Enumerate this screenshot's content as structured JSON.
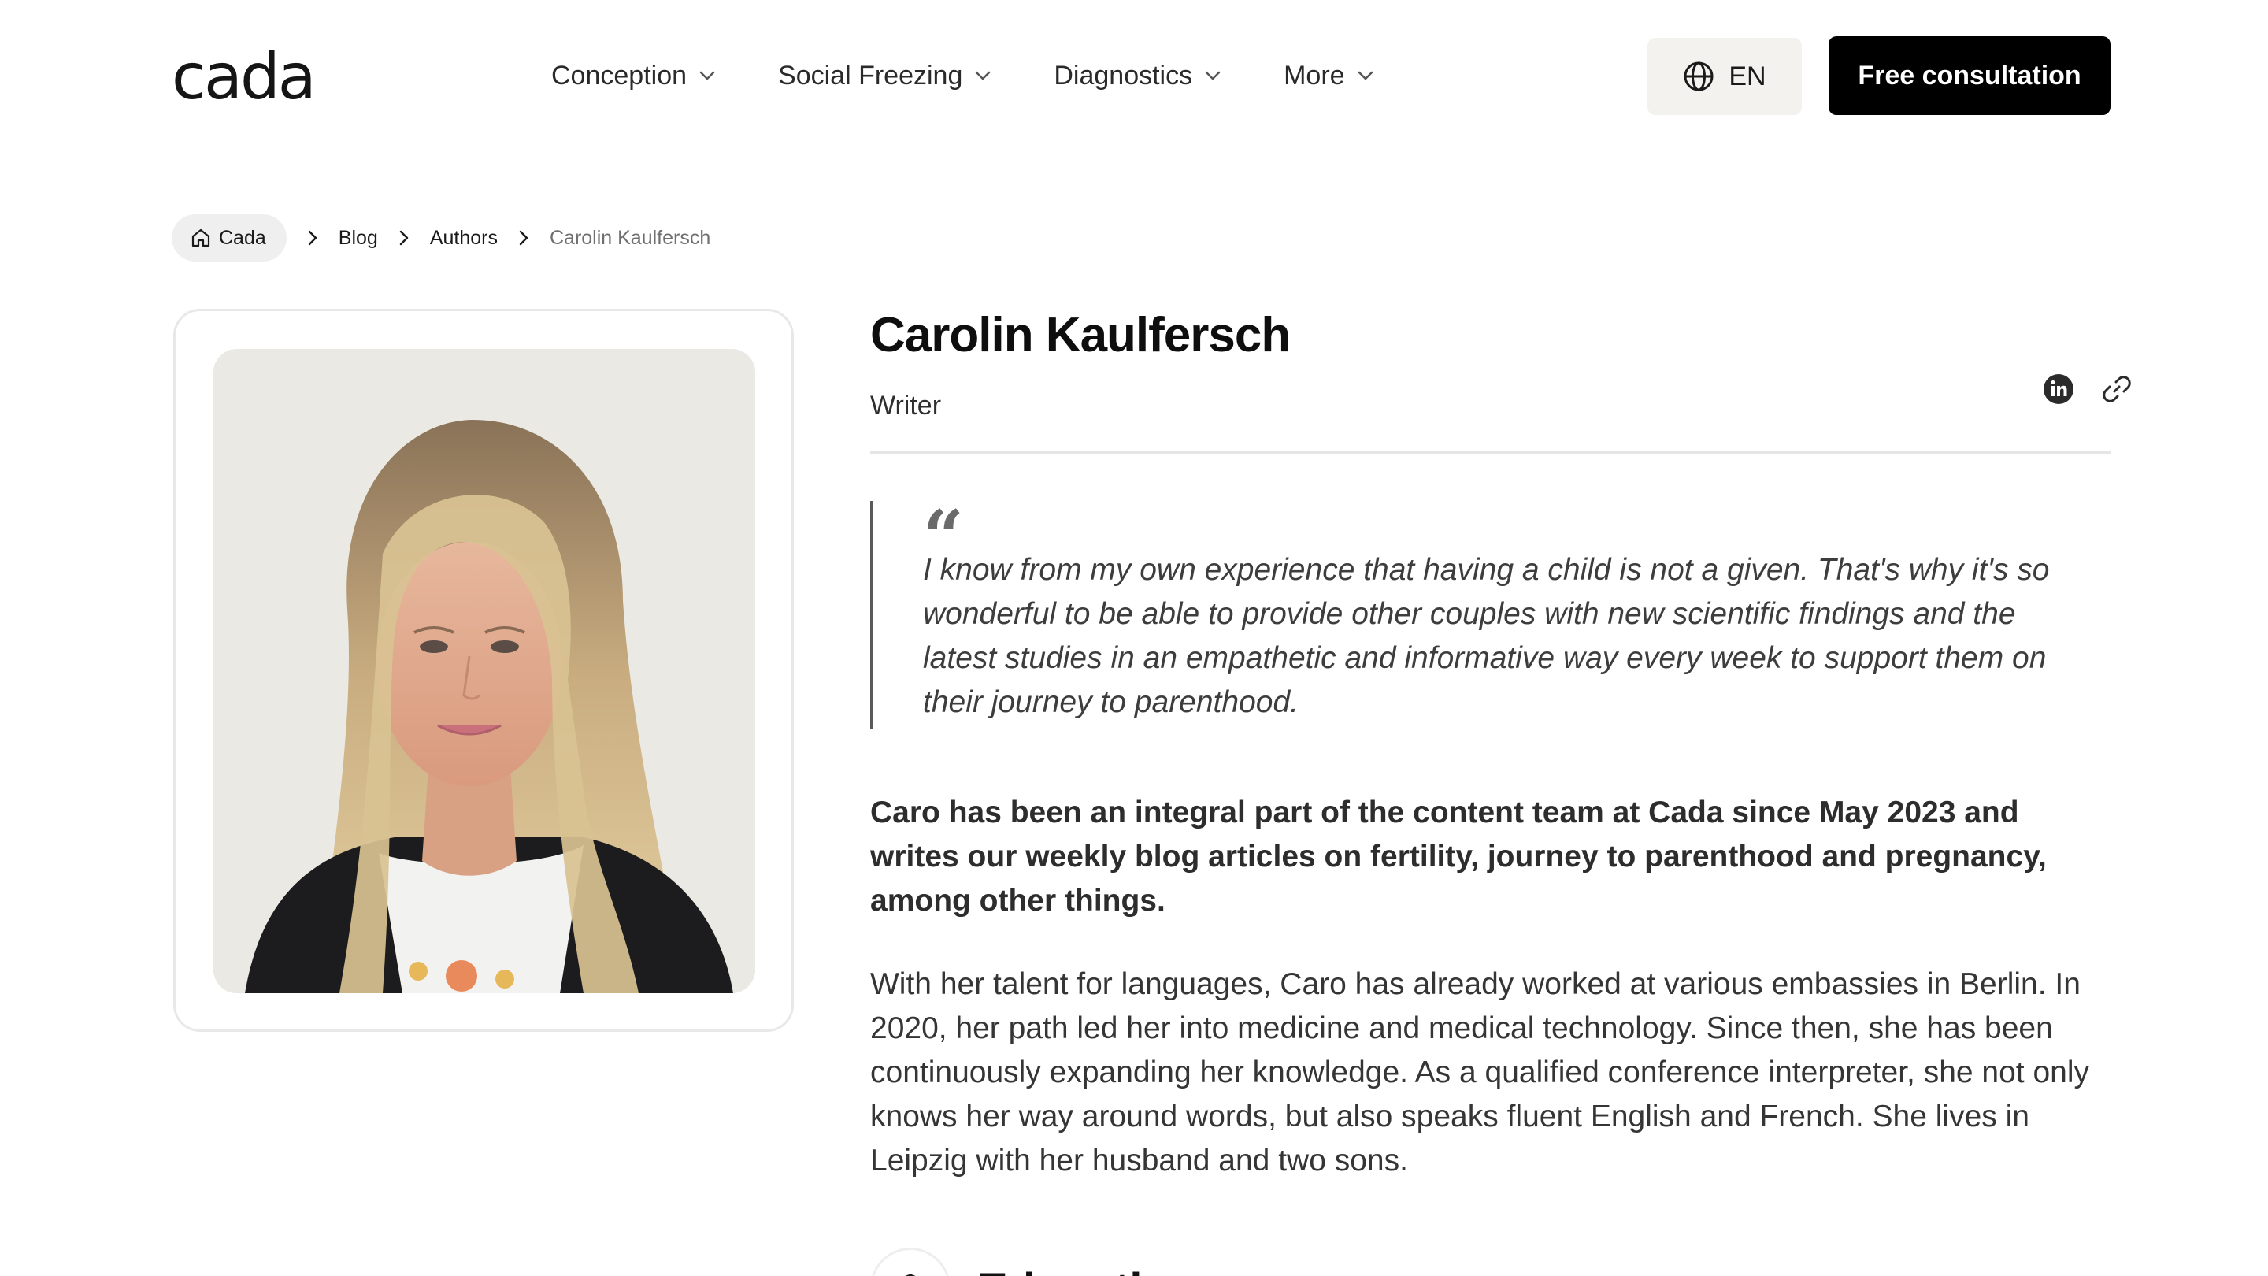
{
  "header": {
    "logo": "cada",
    "nav": [
      {
        "label": "Conception"
      },
      {
        "label": "Social Freezing"
      },
      {
        "label": "Diagnostics"
      },
      {
        "label": "More"
      }
    ],
    "language": {
      "label": "EN",
      "icon": "globe-icon"
    },
    "cta_label": "Free consultation"
  },
  "breadcrumb": {
    "home": "Cada",
    "items": [
      "Blog",
      "Authors"
    ],
    "current": "Carolin Kaulfersch"
  },
  "profile": {
    "name": "Carolin Kaulfersch",
    "role": "Writer",
    "socials": [
      {
        "icon": "linkedin-icon"
      },
      {
        "icon": "link-icon"
      }
    ],
    "quote_mark": "“",
    "quote": "I know from my own experience that having a child is not a given. That's why it's so wonderful to be able to provide other couples with new scientific findings and the latest studies in an empathetic and informative way every week to support them on their journey to parenthood.",
    "bio_lead": "Caro has been an integral part of the content team at Cada since May 2023 and writes our weekly blog articles on fertility, journey to parenthood and pregnancy, among other things.",
    "bio_body": "With her talent for languages, Caro has already worked at various embassies in Berlin. In 2020, her path led her into medicine and medical technology. Since then, she has been continuously expanding her knowledge. As a qualified conference interpreter, she not only knows her way around words, but also speaks fluent English and French. She lives in Leipzig with her husband and two sons.",
    "section_title": "Education"
  },
  "colors": {
    "cta_background": "#000000",
    "lang_background": "#f3f2ee",
    "breadcrumb_home_background": "#efefef",
    "text_primary": "#111111"
  }
}
